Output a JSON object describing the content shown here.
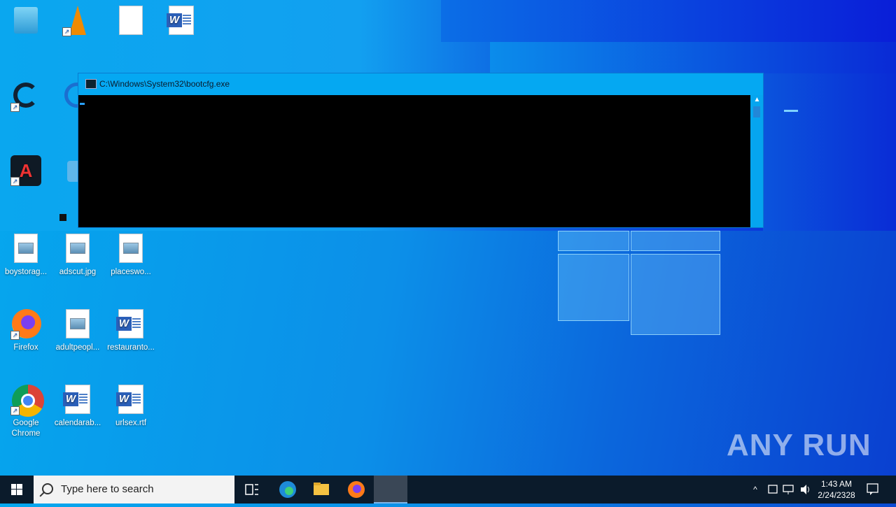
{
  "desktop": {
    "icons": [
      {
        "label": "boystorag...",
        "kind": "image"
      },
      {
        "label": "adscut.jpg",
        "kind": "image"
      },
      {
        "label": "placeswo...",
        "kind": "image"
      },
      {
        "label": "Firefox",
        "kind": "firefox"
      },
      {
        "label": "adultpeopl...",
        "kind": "image"
      },
      {
        "label": "restauranto...",
        "kind": "word"
      },
      {
        "label": "Google Chrome",
        "kind": "chrome"
      },
      {
        "label": "calendarab...",
        "kind": "word"
      },
      {
        "label": "urlsex.rtf",
        "kind": "word"
      }
    ],
    "top_icons": [
      "recycle-bin-icon",
      "vlc-icon",
      "file-icon",
      "word-icon",
      "ccleaner-icon",
      "edge-icon",
      "acrobat-icon",
      "network-icon"
    ]
  },
  "cmd_window": {
    "title": "C:\\Windows\\System32\\bootcfg.exe"
  },
  "taskbar": {
    "search_placeholder": "Type here to search",
    "time": "1:43 AM",
    "date": "2/24/2328",
    "pinned": [
      "task-view-icon",
      "edge-icon",
      "file-explorer-icon",
      "firefox-icon",
      "cmd-active-icon"
    ]
  },
  "watermark": "ANY RUN"
}
